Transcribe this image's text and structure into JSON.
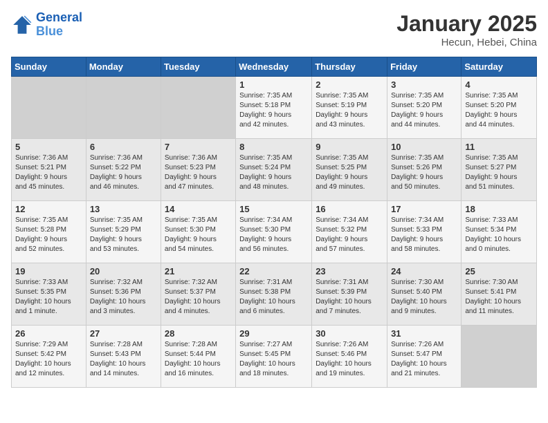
{
  "header": {
    "logo_line1": "General",
    "logo_line2": "Blue",
    "month": "January 2025",
    "location": "Hecun, Hebei, China"
  },
  "weekdays": [
    "Sunday",
    "Monday",
    "Tuesday",
    "Wednesday",
    "Thursday",
    "Friday",
    "Saturday"
  ],
  "weeks": [
    [
      {
        "day": "",
        "info": ""
      },
      {
        "day": "",
        "info": ""
      },
      {
        "day": "",
        "info": ""
      },
      {
        "day": "1",
        "info": "Sunrise: 7:35 AM\nSunset: 5:18 PM\nDaylight: 9 hours\nand 42 minutes."
      },
      {
        "day": "2",
        "info": "Sunrise: 7:35 AM\nSunset: 5:19 PM\nDaylight: 9 hours\nand 43 minutes."
      },
      {
        "day": "3",
        "info": "Sunrise: 7:35 AM\nSunset: 5:20 PM\nDaylight: 9 hours\nand 44 minutes."
      },
      {
        "day": "4",
        "info": "Sunrise: 7:35 AM\nSunset: 5:20 PM\nDaylight: 9 hours\nand 44 minutes."
      }
    ],
    [
      {
        "day": "5",
        "info": "Sunrise: 7:36 AM\nSunset: 5:21 PM\nDaylight: 9 hours\nand 45 minutes."
      },
      {
        "day": "6",
        "info": "Sunrise: 7:36 AM\nSunset: 5:22 PM\nDaylight: 9 hours\nand 46 minutes."
      },
      {
        "day": "7",
        "info": "Sunrise: 7:36 AM\nSunset: 5:23 PM\nDaylight: 9 hours\nand 47 minutes."
      },
      {
        "day": "8",
        "info": "Sunrise: 7:35 AM\nSunset: 5:24 PM\nDaylight: 9 hours\nand 48 minutes."
      },
      {
        "day": "9",
        "info": "Sunrise: 7:35 AM\nSunset: 5:25 PM\nDaylight: 9 hours\nand 49 minutes."
      },
      {
        "day": "10",
        "info": "Sunrise: 7:35 AM\nSunset: 5:26 PM\nDaylight: 9 hours\nand 50 minutes."
      },
      {
        "day": "11",
        "info": "Sunrise: 7:35 AM\nSunset: 5:27 PM\nDaylight: 9 hours\nand 51 minutes."
      }
    ],
    [
      {
        "day": "12",
        "info": "Sunrise: 7:35 AM\nSunset: 5:28 PM\nDaylight: 9 hours\nand 52 minutes."
      },
      {
        "day": "13",
        "info": "Sunrise: 7:35 AM\nSunset: 5:29 PM\nDaylight: 9 hours\nand 53 minutes."
      },
      {
        "day": "14",
        "info": "Sunrise: 7:35 AM\nSunset: 5:30 PM\nDaylight: 9 hours\nand 54 minutes."
      },
      {
        "day": "15",
        "info": "Sunrise: 7:34 AM\nSunset: 5:30 PM\nDaylight: 9 hours\nand 56 minutes."
      },
      {
        "day": "16",
        "info": "Sunrise: 7:34 AM\nSunset: 5:32 PM\nDaylight: 9 hours\nand 57 minutes."
      },
      {
        "day": "17",
        "info": "Sunrise: 7:34 AM\nSunset: 5:33 PM\nDaylight: 9 hours\nand 58 minutes."
      },
      {
        "day": "18",
        "info": "Sunrise: 7:33 AM\nSunset: 5:34 PM\nDaylight: 10 hours\nand 0 minutes."
      }
    ],
    [
      {
        "day": "19",
        "info": "Sunrise: 7:33 AM\nSunset: 5:35 PM\nDaylight: 10 hours\nand 1 minute."
      },
      {
        "day": "20",
        "info": "Sunrise: 7:32 AM\nSunset: 5:36 PM\nDaylight: 10 hours\nand 3 minutes."
      },
      {
        "day": "21",
        "info": "Sunrise: 7:32 AM\nSunset: 5:37 PM\nDaylight: 10 hours\nand 4 minutes."
      },
      {
        "day": "22",
        "info": "Sunrise: 7:31 AM\nSunset: 5:38 PM\nDaylight: 10 hours\nand 6 minutes."
      },
      {
        "day": "23",
        "info": "Sunrise: 7:31 AM\nSunset: 5:39 PM\nDaylight: 10 hours\nand 7 minutes."
      },
      {
        "day": "24",
        "info": "Sunrise: 7:30 AM\nSunset: 5:40 PM\nDaylight: 10 hours\nand 9 minutes."
      },
      {
        "day": "25",
        "info": "Sunrise: 7:30 AM\nSunset: 5:41 PM\nDaylight: 10 hours\nand 11 minutes."
      }
    ],
    [
      {
        "day": "26",
        "info": "Sunrise: 7:29 AM\nSunset: 5:42 PM\nDaylight: 10 hours\nand 12 minutes."
      },
      {
        "day": "27",
        "info": "Sunrise: 7:28 AM\nSunset: 5:43 PM\nDaylight: 10 hours\nand 14 minutes."
      },
      {
        "day": "28",
        "info": "Sunrise: 7:28 AM\nSunset: 5:44 PM\nDaylight: 10 hours\nand 16 minutes."
      },
      {
        "day": "29",
        "info": "Sunrise: 7:27 AM\nSunset: 5:45 PM\nDaylight: 10 hours\nand 18 minutes."
      },
      {
        "day": "30",
        "info": "Sunrise: 7:26 AM\nSunset: 5:46 PM\nDaylight: 10 hours\nand 19 minutes."
      },
      {
        "day": "31",
        "info": "Sunrise: 7:26 AM\nSunset: 5:47 PM\nDaylight: 10 hours\nand 21 minutes."
      },
      {
        "day": "",
        "info": ""
      }
    ]
  ]
}
